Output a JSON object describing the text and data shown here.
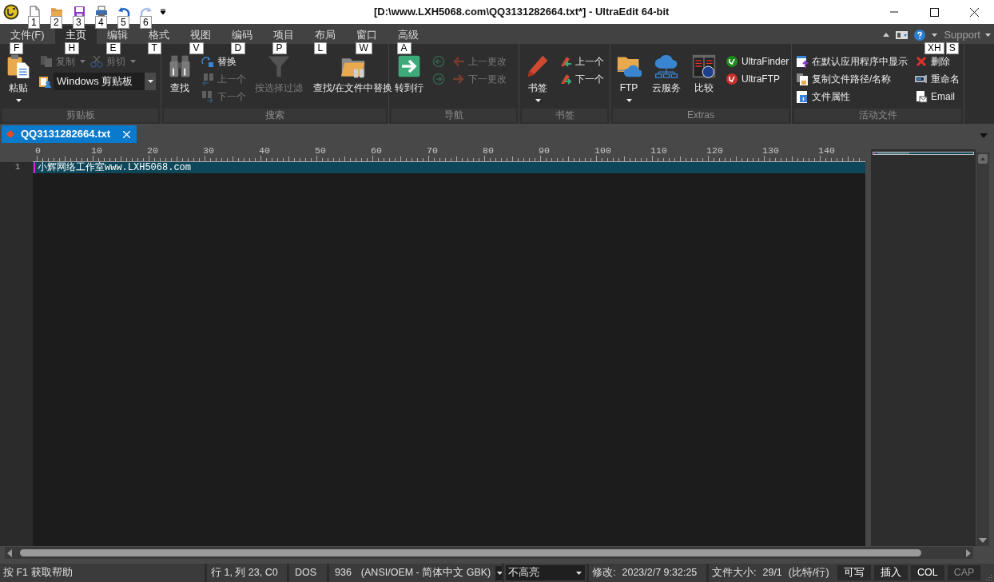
{
  "window": {
    "title": "[D:\\www.LXH5068.com\\QQ3131282664.txt*] - UltraEdit 64-bit"
  },
  "quick_access": [
    {
      "key_tip": "1",
      "disabled": false
    },
    {
      "key_tip": "2",
      "disabled": false
    },
    {
      "key_tip": "3",
      "disabled": false
    },
    {
      "key_tip": "4",
      "disabled": false
    },
    {
      "key_tip": "5",
      "disabled": false
    },
    {
      "key_tip": "6",
      "disabled": true
    }
  ],
  "menu_tabs": [
    {
      "label": "文件(F)",
      "key_tip": "F",
      "selected": false
    },
    {
      "label": "主页",
      "key_tip": "H",
      "selected": true
    },
    {
      "label": "编辑",
      "key_tip": "E",
      "selected": false
    },
    {
      "label": "格式",
      "key_tip": "T",
      "selected": false
    },
    {
      "label": "视图",
      "key_tip": "V",
      "selected": false
    },
    {
      "label": "编码",
      "key_tip": "D",
      "selected": false
    },
    {
      "label": "项目",
      "key_tip": "P",
      "selected": false
    },
    {
      "label": "布局",
      "key_tip": "L",
      "selected": false
    },
    {
      "label": "窗口",
      "key_tip": "W",
      "selected": false
    },
    {
      "label": "高级",
      "key_tip": "A",
      "selected": false
    }
  ],
  "help_bar": {
    "label": "Support"
  },
  "ribbon_key_tips": [
    "XH",
    "S"
  ],
  "ribbon_groups": [
    {
      "label": "剪贴板",
      "columns": [
        {
          "rows": [
            [
              {
                "kind": "large",
                "label": "粘贴",
                "disabled": false,
                "dropdown": true
              }
            ]
          ]
        },
        {
          "rows": [
            [
              {
                "kind": "small",
                "label": "复制",
                "disabled": true,
                "dropdown": true
              },
              {
                "kind": "small",
                "label": "剪切",
                "disabled": true,
                "dropdown": true
              }
            ],
            [
              {
                "kind": "combo",
                "label": "Windows 剪贴板",
                "disabled": false
              }
            ]
          ]
        }
      ]
    },
    {
      "label": "搜索",
      "columns": [
        {
          "rows": [
            [
              {
                "kind": "large",
                "label": "查找",
                "disabled": false
              }
            ]
          ]
        },
        {
          "rows": [
            [
              {
                "kind": "small",
                "label": "替换",
                "disabled": false
              }
            ],
            [
              {
                "kind": "small",
                "label": "上一个",
                "disabled": true
              }
            ],
            [
              {
                "kind": "small",
                "label": "下一个",
                "disabled": true
              }
            ]
          ]
        },
        {
          "rows": [
            [
              {
                "kind": "large",
                "label": "按选择过滤",
                "disabled": true
              }
            ]
          ]
        },
        {
          "rows": [
            [
              {
                "kind": "large",
                "label": "查找/在文件中替换",
                "disabled": false
              }
            ]
          ]
        }
      ]
    },
    {
      "label": "导航",
      "columns": [
        {
          "rows": [
            [
              {
                "kind": "large",
                "label": "转到行",
                "disabled": false
              }
            ]
          ]
        },
        {
          "rows": [
            [
              {
                "kind": "small",
                "disabled": true
              }
            ],
            [
              {
                "kind": "small",
                "disabled": true
              }
            ]
          ]
        },
        {
          "rows": [
            [
              {
                "kind": "small",
                "label": "上一更改",
                "disabled": true
              }
            ],
            [
              {
                "kind": "small",
                "label": "下一更改",
                "disabled": true
              }
            ]
          ]
        }
      ]
    },
    {
      "label": "书签",
      "columns": [
        {
          "rows": [
            [
              {
                "kind": "large",
                "label": "书签",
                "disabled": false,
                "dropdown": true
              }
            ]
          ]
        },
        {
          "rows": [
            [
              {
                "kind": "small",
                "label": "上一个",
                "disabled": false
              }
            ],
            [
              {
                "kind": "small",
                "label": "下一个",
                "disabled": false
              }
            ]
          ]
        }
      ]
    },
    {
      "label": "Extras",
      "columns": [
        {
          "rows": [
            [
              {
                "kind": "large",
                "label": "FTP",
                "disabled": false,
                "dropdown": true
              }
            ]
          ]
        },
        {
          "rows": [
            [
              {
                "kind": "large",
                "label": "云服务",
                "disabled": false
              }
            ]
          ]
        },
        {
          "rows": [
            [
              {
                "kind": "large",
                "label": "比较",
                "disabled": false
              }
            ]
          ]
        },
        {
          "rows": [
            [
              {
                "kind": "small",
                "label": "UltraFinder",
                "disabled": false
              }
            ],
            [
              {
                "kind": "small",
                "label": "UltraFTP",
                "disabled": false
              }
            ]
          ]
        }
      ]
    },
    {
      "label": "活动文件",
      "columns": [
        {
          "rows": [
            [
              {
                "kind": "small",
                "label": "在默认应用程序中显示",
                "disabled": false
              }
            ],
            [
              {
                "kind": "small",
                "label": "复制文件路径/名称",
                "disabled": false
              }
            ],
            [
              {
                "kind": "small",
                "label": "文件属性",
                "disabled": false
              }
            ]
          ]
        },
        {
          "rows": [
            [
              {
                "kind": "small",
                "label": "删除",
                "disabled": false
              }
            ],
            [
              {
                "kind": "small",
                "label": "重命名",
                "disabled": false
              }
            ],
            [
              {
                "kind": "small",
                "label": "Email",
                "disabled": false
              }
            ]
          ]
        }
      ]
    }
  ],
  "document_tabs": [
    {
      "label": "QQ3131282664.txt",
      "modified": true,
      "selected": true
    }
  ],
  "ruler": {
    "labels": [
      "0",
      "10",
      "20",
      "30",
      "40",
      "50",
      "60",
      "70",
      "80",
      "90",
      "100",
      "110",
      "120",
      "130",
      "140"
    ]
  },
  "editor": {
    "lines": [
      {
        "number": "1",
        "text": "小辉网络工作室www.LXH5068.com",
        "current": true
      }
    ]
  },
  "status_bar": {
    "help": "按 F1 获取帮助",
    "position": "行 1, 列 23, C0",
    "line_ending": "DOS",
    "codepage": "936",
    "encoding": "(ANSI/OEM - 简体中文 GBK)",
    "highlighting": "不高亮",
    "modified_label": "修改:",
    "modified": "2023/2/7 9:32:25",
    "size_label": "文件大小:",
    "size": "29/1",
    "size_unit": "(比特/行)",
    "toggles": [
      {
        "label": "可写",
        "on": true
      },
      {
        "label": "插入",
        "on": true
      },
      {
        "label": "COL",
        "on": true
      },
      {
        "label": "CAP",
        "on": false
      }
    ]
  }
}
